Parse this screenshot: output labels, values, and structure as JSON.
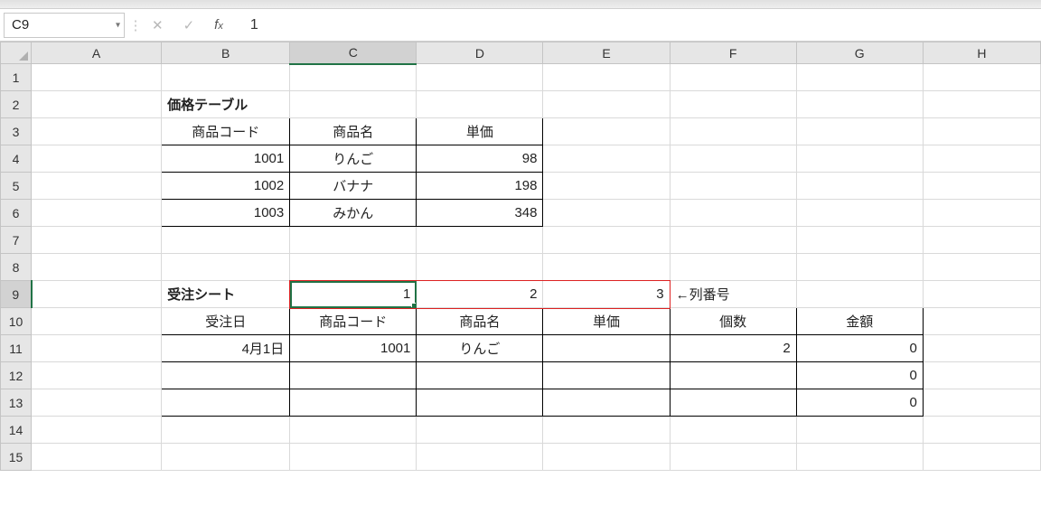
{
  "formulaBar": {
    "nameBox": "C9",
    "value": "1"
  },
  "columns": [
    "A",
    "B",
    "C",
    "D",
    "E",
    "F",
    "G",
    "H"
  ],
  "cells": {
    "B2": "価格テーブル",
    "B3": "商品コード",
    "C3": "商品名",
    "D3": "単価",
    "B4": "1001",
    "C4": "りんご",
    "D4": "98",
    "B5": "1002",
    "C5": "バナナ",
    "D5": "198",
    "B6": "1003",
    "C6": "みかん",
    "D6": "348",
    "B9": "受注シート",
    "C9": "1",
    "D9": "2",
    "E9": "3",
    "F9": "←列番号",
    "B10": "受注日",
    "C10": "商品コード",
    "D10": "商品名",
    "E10": "単価",
    "F10": "個数",
    "G10": "金額",
    "B11": "4月1日",
    "C11": "1001",
    "D11": "りんご",
    "F11": "2",
    "G11": "0",
    "G12": "0",
    "G13": "0"
  },
  "selection": {
    "cell": "C9",
    "col": "C",
    "row": 9
  },
  "annotation": {
    "range": "C9:E9"
  }
}
